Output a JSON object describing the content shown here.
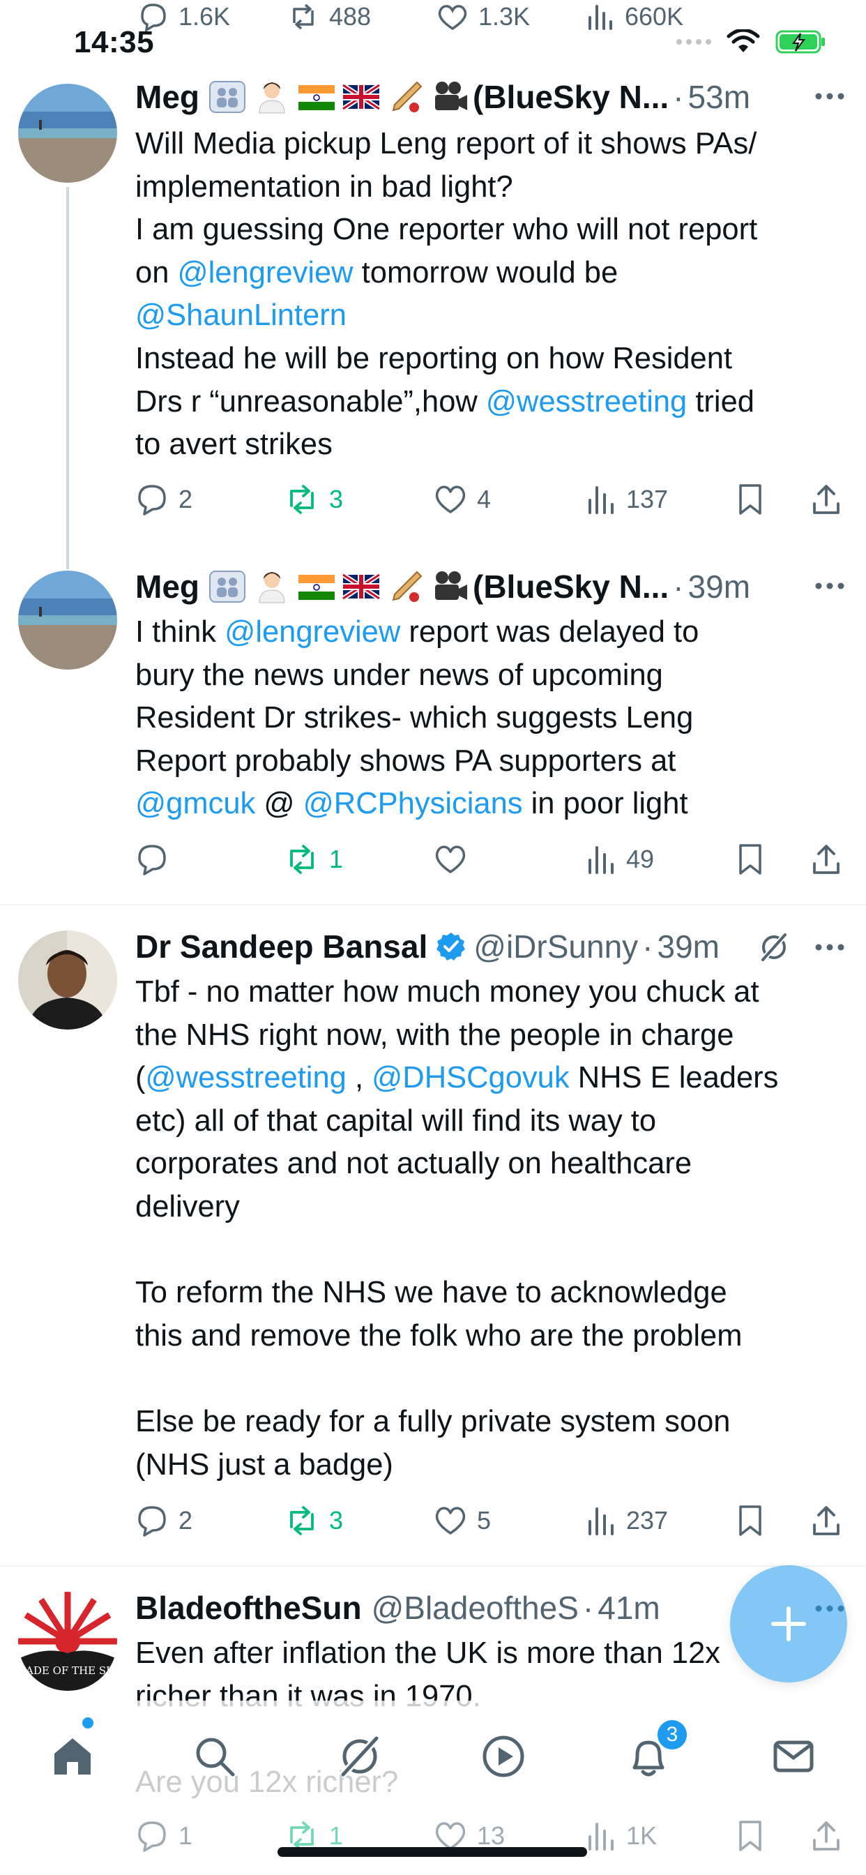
{
  "status_bar": {
    "time": "14:35"
  },
  "previous_tweet_actions": {
    "replies": "1.6K",
    "reposts": "488",
    "likes": "1.3K",
    "views": "660K"
  },
  "tweets": [
    {
      "name": "Meg",
      "name_suffix": "(BlueSky N...",
      "time": "53m",
      "lines": [
        [
          "Will Media pickup Leng report of it shows PAs/"
        ],
        [
          "implementation in bad light?"
        ],
        [
          "I am guessing One reporter who will not report"
        ],
        [
          "on ",
          {
            "m": "@lengreview"
          },
          " tomorrow would be"
        ],
        [
          {
            "m": "@ShaunLintern"
          }
        ],
        [
          "Instead he will be reporting on how Resident"
        ],
        [
          "Drs r “unreasonable”,how ",
          {
            "m": "@wesstreeting"
          },
          " tried"
        ],
        [
          "to avert strikes"
        ]
      ],
      "replies": "2",
      "reposts": "3",
      "likes": "4",
      "views": "137"
    },
    {
      "name": "Meg",
      "name_suffix": "(BlueSky N...",
      "time": "39m",
      "lines": [
        [
          "I think ",
          {
            "m": "@lengreview"
          },
          " report was delayed to"
        ],
        [
          "bury the news under news of upcoming"
        ],
        [
          "Resident Dr strikes- which suggests Leng"
        ],
        [
          "Report probably shows PA supporters at"
        ],
        [
          {
            "m": "@gmcuk"
          },
          " @ ",
          {
            "m": "@RCPhysicians"
          },
          " in poor light"
        ]
      ],
      "replies": "",
      "reposts": "1",
      "likes": "",
      "views": "49"
    },
    {
      "name": "Dr Sandeep Bansal",
      "handle": "@iDrSunny",
      "time": "39m",
      "lines": [
        [
          "Tbf - no matter how much money you chuck at"
        ],
        [
          "the NHS right now, with the people in charge"
        ],
        [
          "(",
          {
            "m": "@wesstreeting"
          },
          " , ",
          {
            "m": "@DHSCgovuk"
          },
          " NHS E leaders"
        ],
        [
          "etc) all of that capital will find its way to"
        ],
        [
          "corporates and not actually on healthcare"
        ],
        [
          "delivery"
        ],
        [
          ""
        ],
        [
          "To reform the NHS we have to acknowledge"
        ],
        [
          "this and remove the folk who are the problem"
        ],
        [
          ""
        ],
        [
          "Else be ready for a fully private system soon"
        ],
        [
          "(NHS just a badge)"
        ]
      ],
      "replies": "2",
      "reposts": "3",
      "likes": "5",
      "views": "237"
    },
    {
      "name": "BladeoftheSun",
      "handle": "@BladeoftheS",
      "time": "41m",
      "avatar_text": "BLADE OF THE SUN",
      "lines": [
        [
          "Even after inflation the UK is more than 12x"
        ],
        [
          "richer than it was in 1970."
        ],
        [
          ""
        ],
        [
          "Are you 12x richer?"
        ]
      ],
      "replies": "1",
      "reposts": "1",
      "likes": "13",
      "views": "1K"
    }
  ],
  "tabbar": {
    "items": [
      "home-icon",
      "search-icon",
      "grok-icon",
      "video-icon",
      "notifications-icon",
      "messages-icon"
    ],
    "notification_badge": "3"
  },
  "colors": {
    "accent": "#1d9bf0",
    "repost_green": "#00ba7c",
    "muted": "#536471",
    "text": "#0f1419"
  }
}
